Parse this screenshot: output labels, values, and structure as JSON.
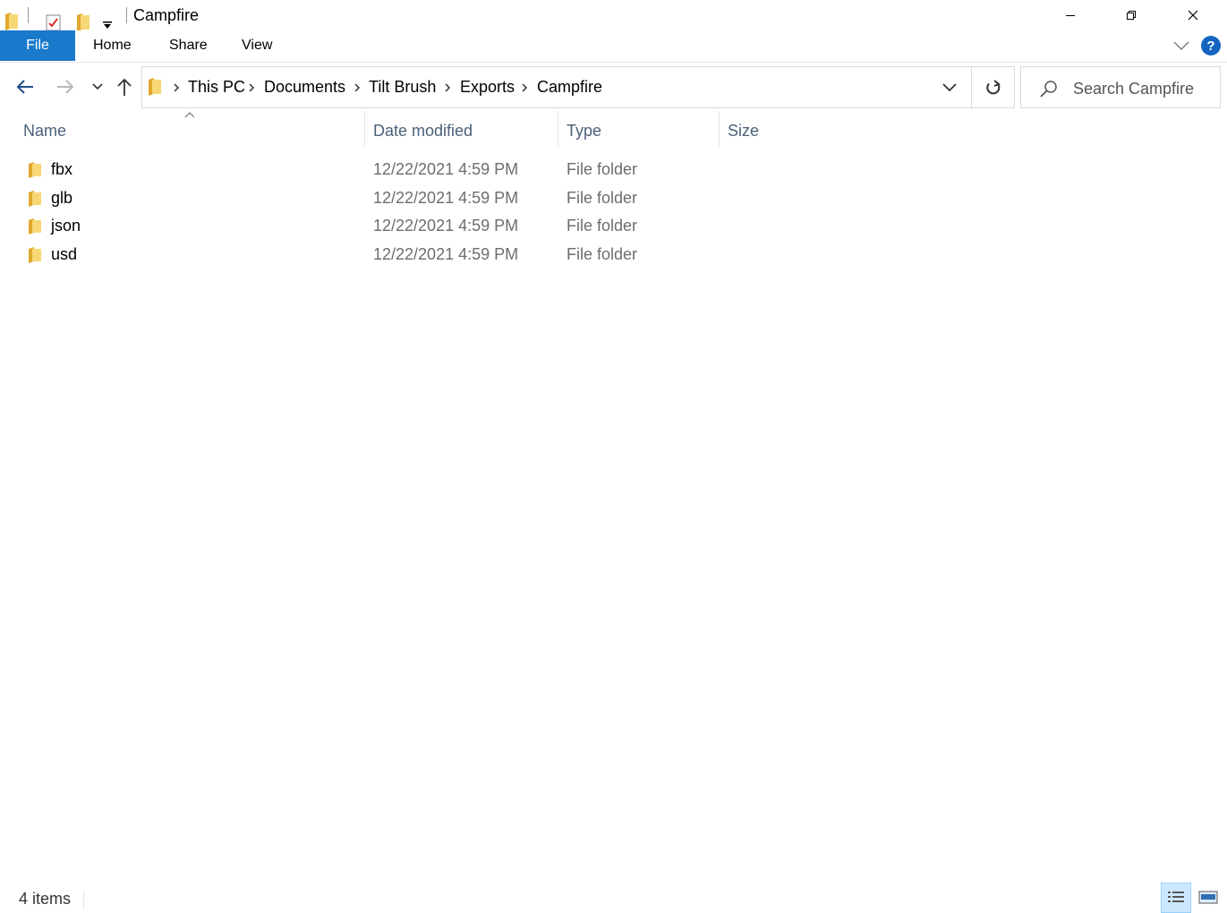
{
  "window": {
    "title": "Campfire",
    "controls": {
      "minimize": "—",
      "restore": "❐",
      "close": "✕"
    }
  },
  "ribbon": {
    "tabs": [
      {
        "label": "File",
        "active": true
      },
      {
        "label": "Home"
      },
      {
        "label": "Share"
      },
      {
        "label": "View"
      }
    ],
    "help": "?"
  },
  "nav": {
    "breadcrumbs": [
      "This PC",
      "Documents",
      "Tilt Brush",
      "Exports",
      "Campfire"
    ],
    "search_placeholder": "Search Campfire"
  },
  "file_list": {
    "columns": [
      "Name",
      "Date modified",
      "Type",
      "Size"
    ],
    "sort_column": "Name",
    "rows": [
      {
        "name": "fbx",
        "date": "12/22/2021 4:59 PM",
        "type": "File folder",
        "size": ""
      },
      {
        "name": "glb",
        "date": "12/22/2021 4:59 PM",
        "type": "File folder",
        "size": ""
      },
      {
        "name": "json",
        "date": "12/22/2021 4:59 PM",
        "type": "File folder",
        "size": ""
      },
      {
        "name": "usd",
        "date": "12/22/2021 4:59 PM",
        "type": "File folder",
        "size": ""
      }
    ]
  },
  "status": {
    "item_count": "4 items",
    "active_view": "details"
  },
  "colors": {
    "accent": "#1979ca",
    "header_text": "#4c607a",
    "folder": "#f8d775"
  }
}
